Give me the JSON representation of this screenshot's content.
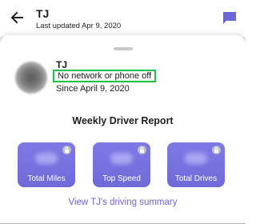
{
  "header": {
    "back_icon": "arrow-left-icon",
    "title": "TJ",
    "subtitle": "Last updated Apr 9, 2020",
    "chat_icon": "chat-bubble-icon",
    "accent": "#6b66d6"
  },
  "driver": {
    "name": "TJ",
    "status": "No network or phone off",
    "since": "Since April 9, 2020",
    "status_highlight_color": "#16c24a"
  },
  "report": {
    "title": "Weekly Driver Report",
    "cards": [
      {
        "label": "Total Miles",
        "icon": "lock-icon"
      },
      {
        "label": "Top Speed",
        "icon": "lock-icon"
      },
      {
        "label": "Total Drives",
        "icon": "lock-icon"
      }
    ],
    "card_color": "#7570e0"
  },
  "summary_link": "View TJ's driving summary"
}
